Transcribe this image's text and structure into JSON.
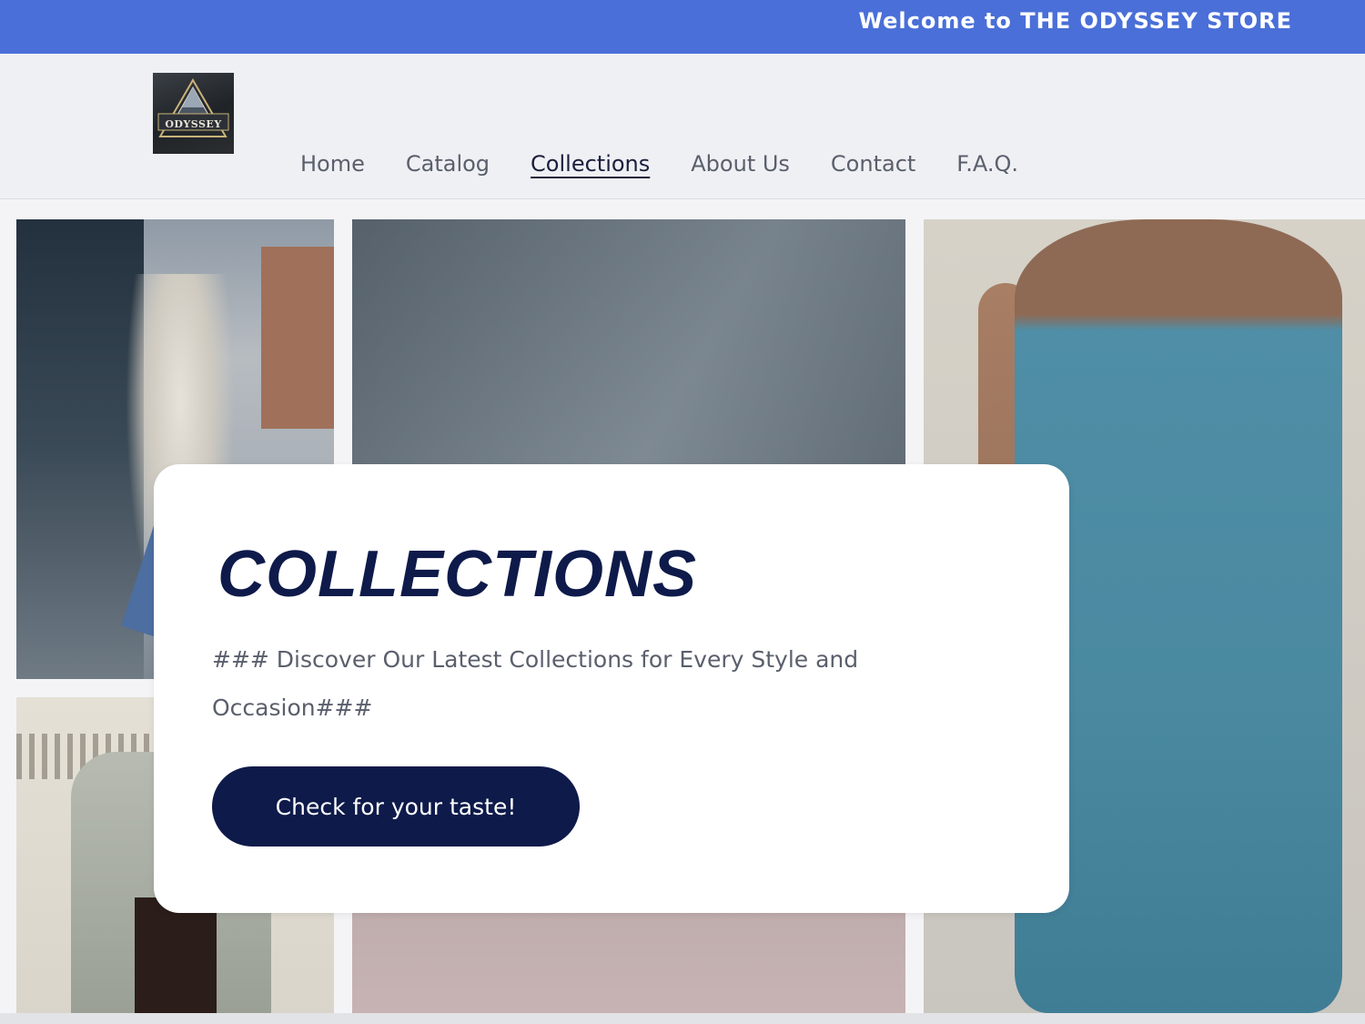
{
  "announcement": {
    "text": "Welcome to THE ODYSSEY STORE"
  },
  "logo": {
    "icon": "odyssey-logo",
    "text": "ODYSSEY"
  },
  "nav": {
    "items": [
      {
        "label": "Home"
      },
      {
        "label": "Catalog"
      },
      {
        "label": "Collections",
        "active": true
      },
      {
        "label": "About Us"
      },
      {
        "label": "Contact"
      },
      {
        "label": "F.A.Q."
      }
    ]
  },
  "hero": {
    "title": "COLLECTIONS",
    "subtitle": "### Discover Our Latest Collections for Every Style and Occasion###",
    "cta_label": "Check for your taste!"
  },
  "colors": {
    "announcement_bg": "#4a6fd8",
    "header_bg": "#eff0f4",
    "title_color": "#0e1a4a",
    "button_bg": "#0e1a4a",
    "nav_text": "#5a5f6c"
  }
}
